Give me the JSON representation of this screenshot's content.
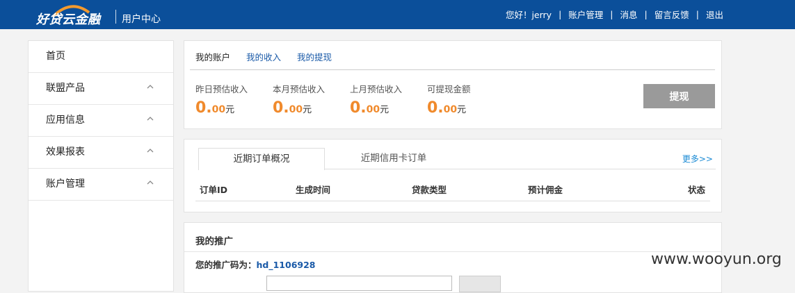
{
  "header": {
    "logo_text": "好贷云金融",
    "subtitle": "用户中心",
    "nav": {
      "greeting": "您好！jerry",
      "account": "账户管理",
      "messages": "消息",
      "feedback": "留言反馈",
      "logout": "退出",
      "separator": "|"
    }
  },
  "sidebar": {
    "items": [
      {
        "label": "首页",
        "icon": ""
      },
      {
        "label": "联盟产品",
        "icon": "chevron-up-icon"
      },
      {
        "label": "应用信息",
        "icon": "chevron-up-icon"
      },
      {
        "label": "效果报表",
        "icon": "chevron-up-icon"
      },
      {
        "label": "账户管理",
        "icon": "chevron-up-icon"
      }
    ]
  },
  "account": {
    "tabs": {
      "my_account": "我的账户",
      "my_income": "我的收入",
      "my_withdraw": "我的提现"
    },
    "stats": [
      {
        "label": "昨日预估收入",
        "int": "0.",
        "dec": "00",
        "unit": "元"
      },
      {
        "label": "本月预估收入",
        "int": "0.",
        "dec": "00",
        "unit": "元"
      },
      {
        "label": "上月预估收入",
        "int": "0.",
        "dec": "00",
        "unit": "元"
      },
      {
        "label": "可提现金额",
        "int": "0.",
        "dec": "00",
        "unit": "元"
      }
    ],
    "withdraw_button": "提现"
  },
  "orders": {
    "tabs": {
      "recent_orders": "近期订单概况",
      "recent_credit": "近期信用卡订单"
    },
    "more": "更多>>",
    "columns": [
      "订单ID",
      "生成时间",
      "贷款类型",
      "预计佣金",
      "状态"
    ]
  },
  "promo": {
    "title": "我的推广",
    "code_label": "您的推广码为：",
    "code": "hd_1106928"
  },
  "watermark": "www.wooyun.org",
  "colors": {
    "header_bg": "#0b4f9a",
    "accent_orange": "#f08a2c",
    "link_blue": "#1a5aa8"
  }
}
